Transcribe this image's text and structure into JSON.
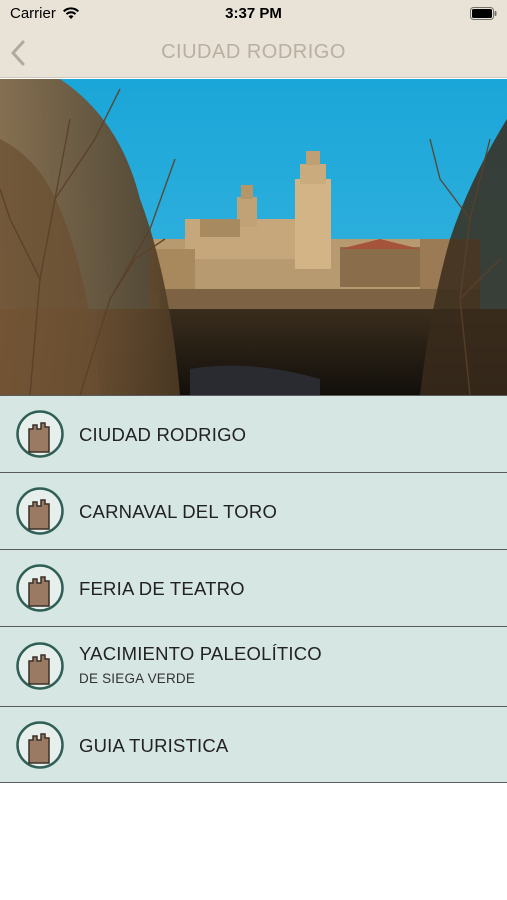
{
  "status_bar": {
    "carrier": "Carrier",
    "time": "3:37 PM",
    "wifi_icon": "wifi-icon",
    "battery_icon": "battery-icon"
  },
  "nav": {
    "title": "CIUDAD RODRIGO",
    "back_icon": "chevron-left-icon"
  },
  "hero": {
    "description_icon": "photo"
  },
  "menu": {
    "items": [
      {
        "label": "CIUDAD RODRIGO",
        "sublabel": "",
        "icon": "castle-tower-icon"
      },
      {
        "label": "CARNAVAL DEL TORO",
        "sublabel": "",
        "icon": "castle-tower-icon"
      },
      {
        "label": "FERIA DE TEATRO",
        "sublabel": "",
        "icon": "castle-tower-icon"
      },
      {
        "label": "YACIMIENTO PALEOLÍTICO",
        "sublabel": "DE SIEGA VERDE",
        "icon": "castle-tower-icon"
      },
      {
        "label": "GUIA TURISTICA",
        "sublabel": "",
        "icon": "castle-tower-icon"
      }
    ]
  },
  "colors": {
    "header_bg": "#e9e2d6",
    "title_color": "#b9afa2",
    "menu_bg": "#d6e6e3",
    "icon_ring": "#2f5f55",
    "icon_tower": "#9a7a62"
  }
}
